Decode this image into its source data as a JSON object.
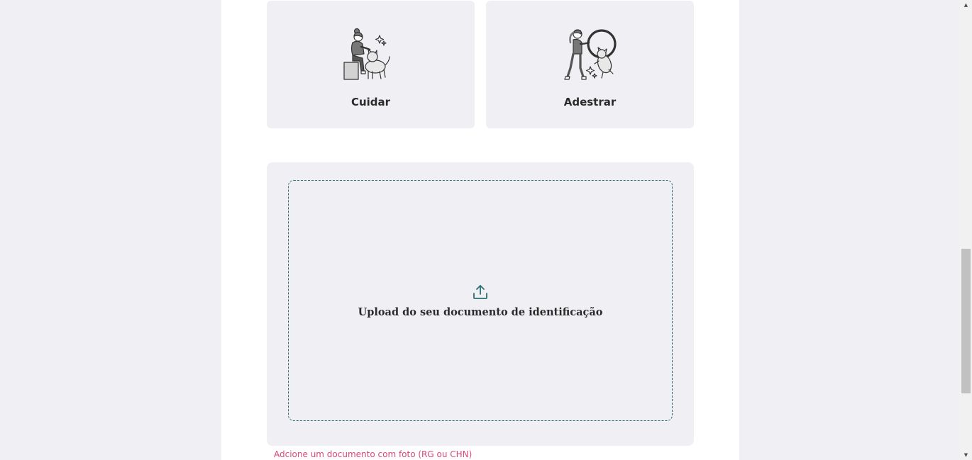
{
  "services": [
    {
      "label": "Cuidar",
      "icon": "person-petting-dog-icon"
    },
    {
      "label": "Adestrar",
      "icon": "person-training-dog-hoop-icon"
    }
  ],
  "upload": {
    "label": "Upload do seu documento de identificação",
    "icon": "upload-icon",
    "hint": "Adcione um documento com foto (RG ou CHN)"
  },
  "colors": {
    "page_background": "#f0eff3",
    "card_background": "#f0eff3",
    "accent_teal": "#2a6f72",
    "hint_pink": "#d9467a",
    "text_dark": "#2b2b2b"
  },
  "scrollbar": {
    "position_fraction": 0.55
  }
}
